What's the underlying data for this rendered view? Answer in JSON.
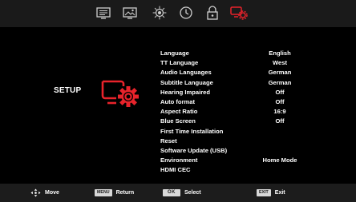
{
  "tabs": [
    {
      "id": "picture",
      "icon": "picture-icon",
      "active": false
    },
    {
      "id": "image",
      "icon": "image-icon",
      "active": false
    },
    {
      "id": "sound",
      "icon": "sound-icon",
      "active": false
    },
    {
      "id": "time",
      "icon": "clock-icon",
      "active": false
    },
    {
      "id": "lock",
      "icon": "lock-icon",
      "active": false
    },
    {
      "id": "setup",
      "icon": "setup-icon",
      "active": true
    }
  ],
  "section": {
    "title": "SETUP",
    "icon": "setup-gear-icon"
  },
  "menu": {
    "items": [
      {
        "label": "Language",
        "value": "English"
      },
      {
        "label": "TT Language",
        "value": "West"
      },
      {
        "label": "Audio Languages",
        "value": "German"
      },
      {
        "label": "Subtitle Language",
        "value": "German"
      },
      {
        "label": "Hearing Impaired",
        "value": "Off"
      },
      {
        "label": "Auto format",
        "value": "Off"
      },
      {
        "label": "Aspect Ratio",
        "value": "16:9"
      },
      {
        "label": "Blue Screen",
        "value": "Off"
      },
      {
        "label": "First Time Installation",
        "value": ""
      },
      {
        "label": "Reset",
        "value": ""
      },
      {
        "label": "Software Update (USB)",
        "value": ""
      },
      {
        "label": "Environment",
        "value": "Home Mode"
      },
      {
        "label": "HDMI CEC",
        "value": ""
      }
    ]
  },
  "footer": {
    "move": {
      "icon": "dpad-icon",
      "label": "Move"
    },
    "return": {
      "key": "MENU",
      "label": "Return"
    },
    "select": {
      "key": "OK",
      "label": "Select"
    },
    "exit": {
      "key": "EXIT",
      "label": "Exit"
    }
  },
  "colors": {
    "accent": "#e8232b",
    "icon_grey": "#cfcfcf",
    "top_bar": "#1a1a1a",
    "bottom_bar": "#1c1c1c",
    "background": "#000000"
  }
}
